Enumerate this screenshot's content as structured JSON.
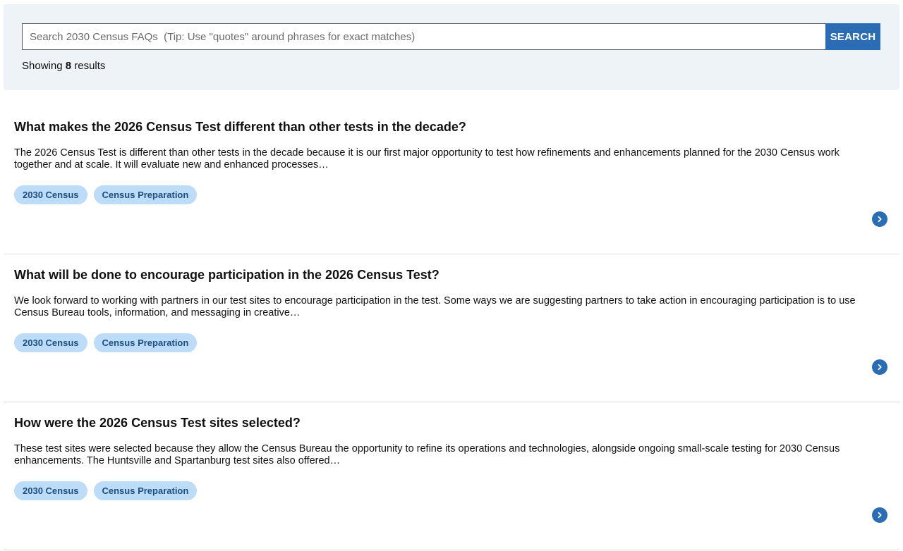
{
  "search": {
    "placeholder": "Search 2030 Census FAQs  (Tip: Use \"quotes\" around phrases for exact matches)",
    "button_label": "SEARCH"
  },
  "results": {
    "prefix": "Showing ",
    "count": "8",
    "suffix": " results"
  },
  "faqs": [
    {
      "title": "What makes the 2026 Census Test different than other tests in the decade?",
      "snippet": "The 2026 Census Test is different than other tests in the decade because it is our first major opportunity to test how refinements and enhancements planned for the 2030 Census work together and at scale. It will evaluate new and enhanced processes…",
      "tags": [
        "2030 Census",
        "Census Preparation"
      ],
      "icon": "chevron-right-icon"
    },
    {
      "title": "What will be done to encourage participation in the 2026 Census Test?",
      "snippet": "We look forward to working with partners in our test sites to encourage participation in the test. Some ways we are suggesting partners to take action in encouraging participation is to use Census Bureau tools, information, and messaging in creative…",
      "tags": [
        "2030 Census",
        "Census Preparation"
      ],
      "icon": "chevron-right-icon"
    },
    {
      "title": "How were the 2026 Census Test sites selected?",
      "snippet": "These test sites were selected because they allow the Census Bureau the opportunity to refine its operations and technologies, alongside ongoing small-scale testing for 2030 Census enhancements. The Huntsville and Spartanburg test sites also offered…",
      "tags": [
        "2030 Census",
        "Census Preparation"
      ],
      "icon": "chevron-right-icon"
    }
  ],
  "colors": {
    "accent": "#2a6db5",
    "panel_bg": "#eef3f7",
    "tag_bg": "#bcdcf8",
    "tag_text": "#1f4f82"
  }
}
